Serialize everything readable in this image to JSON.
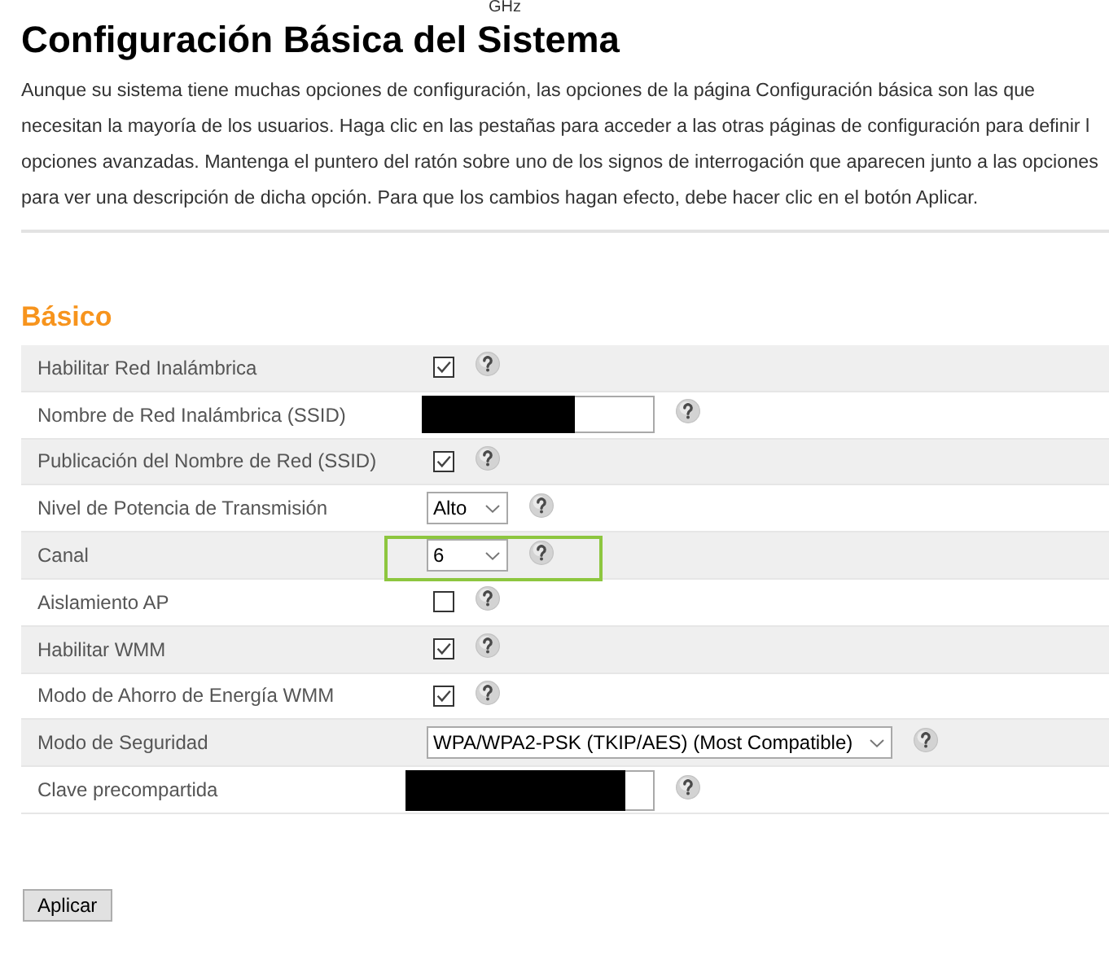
{
  "header": {
    "top_text": "GHz",
    "title": "Configuración Básica del Sistema",
    "intro_lines": [
      "Aunque su sistema tiene muchas opciones de configuración, las opciones de la página Configuración básica son las que",
      "necesitan la mayoría de los usuarios. Haga clic en las pestañas para acceder a las otras páginas de configuración para definir l",
      "opciones avanzadas. Mantenga el puntero del ratón sobre uno de los signos de interrogación que aparecen junto a las opciones",
      "para ver una descripción de dicha opción. Para que los cambios hagan efecto, debe hacer clic en el botón Aplicar."
    ]
  },
  "section": {
    "title": "Básico",
    "rows": [
      {
        "label": "Habilitar Red Inalámbrica",
        "kind": "checkbox",
        "checked": true,
        "highlighted": false
      },
      {
        "label": "Nombre de Red Inalámbrica (SSID)",
        "kind": "text",
        "redacted": true,
        "highlighted": false
      },
      {
        "label": "Publicación del Nombre de Red (SSID)",
        "kind": "checkbox",
        "checked": true,
        "highlighted": false
      },
      {
        "label": "Nivel de Potencia de Transmisión",
        "kind": "select",
        "value": "Alto",
        "highlighted": false
      },
      {
        "label": "Canal",
        "kind": "select",
        "value": "6",
        "highlighted": true
      },
      {
        "label": "Aislamiento AP",
        "kind": "checkbox",
        "checked": false,
        "highlighted": false
      },
      {
        "label": "Habilitar WMM",
        "kind": "checkbox",
        "checked": true,
        "highlighted": false
      },
      {
        "label": "Modo de Ahorro de Energía WMM",
        "kind": "checkbox",
        "checked": true,
        "highlighted": false
      },
      {
        "label": "Modo de Seguridad",
        "kind": "select",
        "value": "WPA/WPA2-PSK (TKIP/AES) (Most Compatible)",
        "highlighted": false
      },
      {
        "label": "Clave precompartida",
        "kind": "password",
        "redacted": true,
        "highlighted": false
      }
    ]
  },
  "buttons": [
    {
      "label": "Aplicar"
    }
  ]
}
